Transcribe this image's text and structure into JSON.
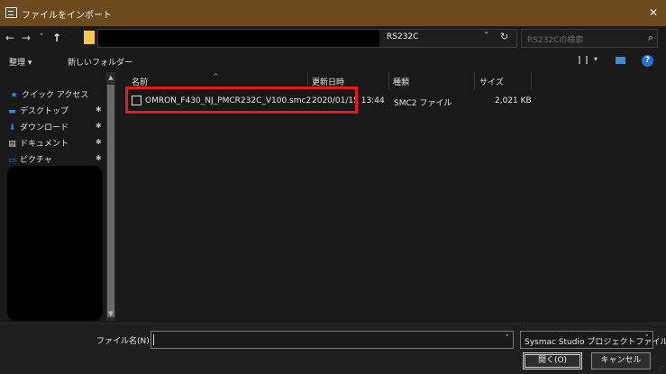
{
  "window": {
    "title": "ファイルをインポート",
    "close_glyph": "✕",
    "icon": "dialog-window-icon",
    "title_bar_color": "#6b4a1e"
  },
  "nav_bar": {
    "back_glyph": "←",
    "forward_glyph": "→",
    "recent_glyph": "˅",
    "up_glyph": "↑",
    "address_last_segment": "RS232C",
    "address_dropdown_glyph": "˅",
    "refresh_glyph": "↻",
    "search_placeholder": "RS232Cの検索",
    "search_glyph": "⌕"
  },
  "toolbar": {
    "organize_label": "整理 ▾",
    "new_folder_label": "新しいフォルダー",
    "view_dropdown_glyph": "▾",
    "help_glyph": "?"
  },
  "sidebar": {
    "items": [
      {
        "icon": "star-icon",
        "glyph": "★",
        "label": "クイック アクセス",
        "color": "#3a8ad6"
      },
      {
        "icon": "desktop-icon",
        "glyph": "▬",
        "label": "デスクトップ",
        "pinned": true,
        "color": "#3a8ad6"
      },
      {
        "icon": "download-icon",
        "glyph": "⬇",
        "label": "ダウンロード",
        "pinned": true,
        "color": "#3a8ad6"
      },
      {
        "icon": "document-icon",
        "glyph": "▤",
        "label": "ドキュメント",
        "pinned": true,
        "color": "#e0e0e0"
      },
      {
        "icon": "pictures-icon",
        "glyph": "▭",
        "label": "ピクチャ",
        "pinned": true,
        "color": "#3a8ad6"
      }
    ],
    "pin_glyph": "✱"
  },
  "file_list": {
    "columns": [
      "名前",
      "更新日時",
      "種類",
      "サイズ"
    ],
    "sort_caret": "^",
    "files": [
      {
        "name": "OMRON_F430_NJ_PMCR232C_V100.smc2",
        "modified": "2020/01/15 13:44",
        "type": "SMC2 ファイル",
        "size": "2,021 KB"
      }
    ]
  },
  "footer": {
    "filename_label": "ファイル名(N):",
    "filename_value": "",
    "filename_dropdown_glyph": "˅",
    "filetype_value": "Sysmac Studio プロジェクトファイル",
    "filetype_dropdown_glyph": "˅",
    "open_button": "開く(O)",
    "cancel_button": "キャンセル"
  },
  "highlight_color": "#e21c1c"
}
